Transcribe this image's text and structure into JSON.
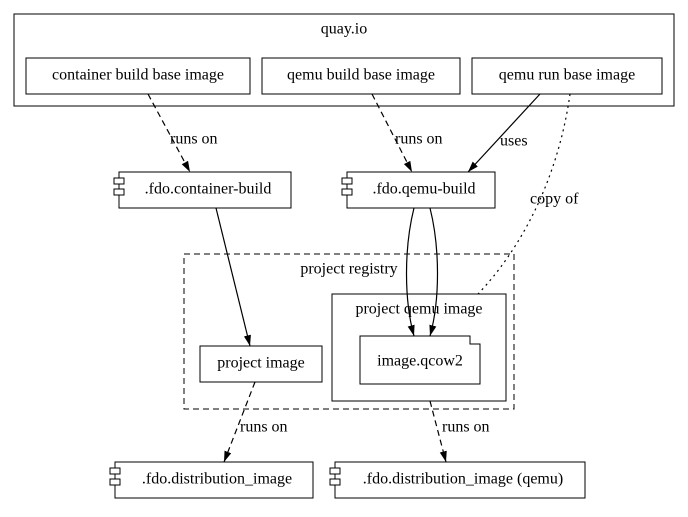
{
  "nodes": {
    "quayio": "quay.io",
    "cbbi": "container build base image",
    "qbbi": "qemu build base image",
    "qrbi": "qemu run base image",
    "cbuild": ".fdo.container-build",
    "qbuild": ".fdo.qemu-build",
    "projreg": "project registry",
    "pimg": "project image",
    "pqimg": "project qemu image",
    "qcow": "image.qcow2",
    "dist": ".fdo.distribution_image",
    "distq": ".fdo.distribution_image (qemu)"
  },
  "edges": {
    "runs_on": "runs on",
    "uses": "uses",
    "copy_of": "copy of"
  }
}
